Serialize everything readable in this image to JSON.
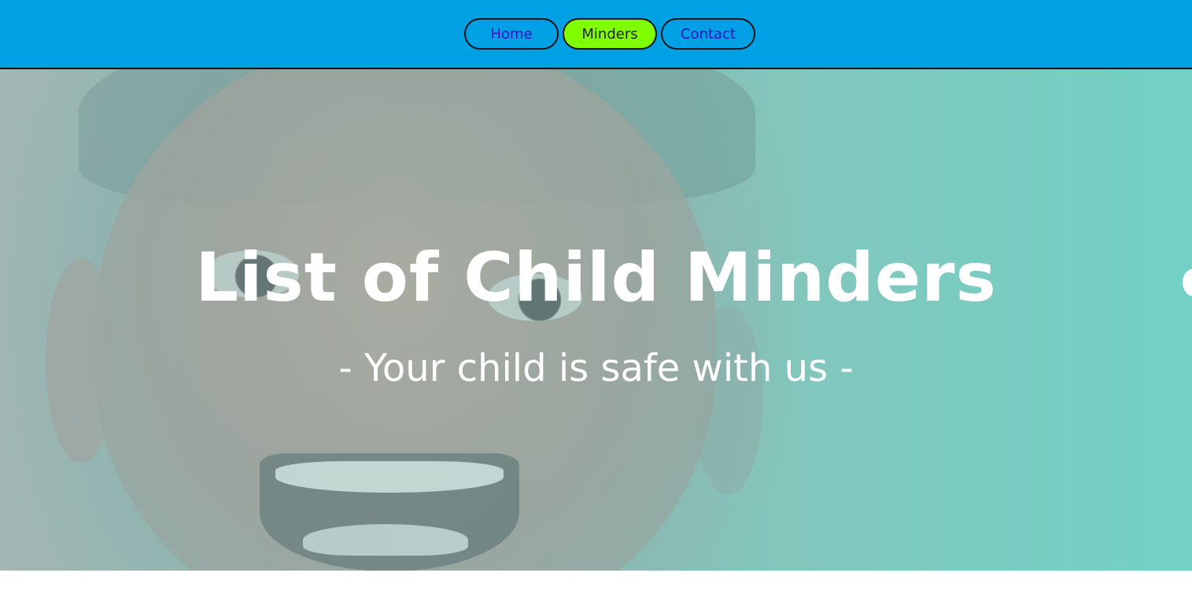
{
  "nav": {
    "items": [
      {
        "label": "Home",
        "active": false
      },
      {
        "label": "Minders",
        "active": true
      },
      {
        "label": "Contact",
        "active": false
      }
    ],
    "active_color": "#7fff00",
    "bar_color": "#00a0e4"
  },
  "hero": {
    "title": "List of Child Minders",
    "subtitle": "- Your child is safe with us -",
    "tint_color": "#73d2c6"
  }
}
